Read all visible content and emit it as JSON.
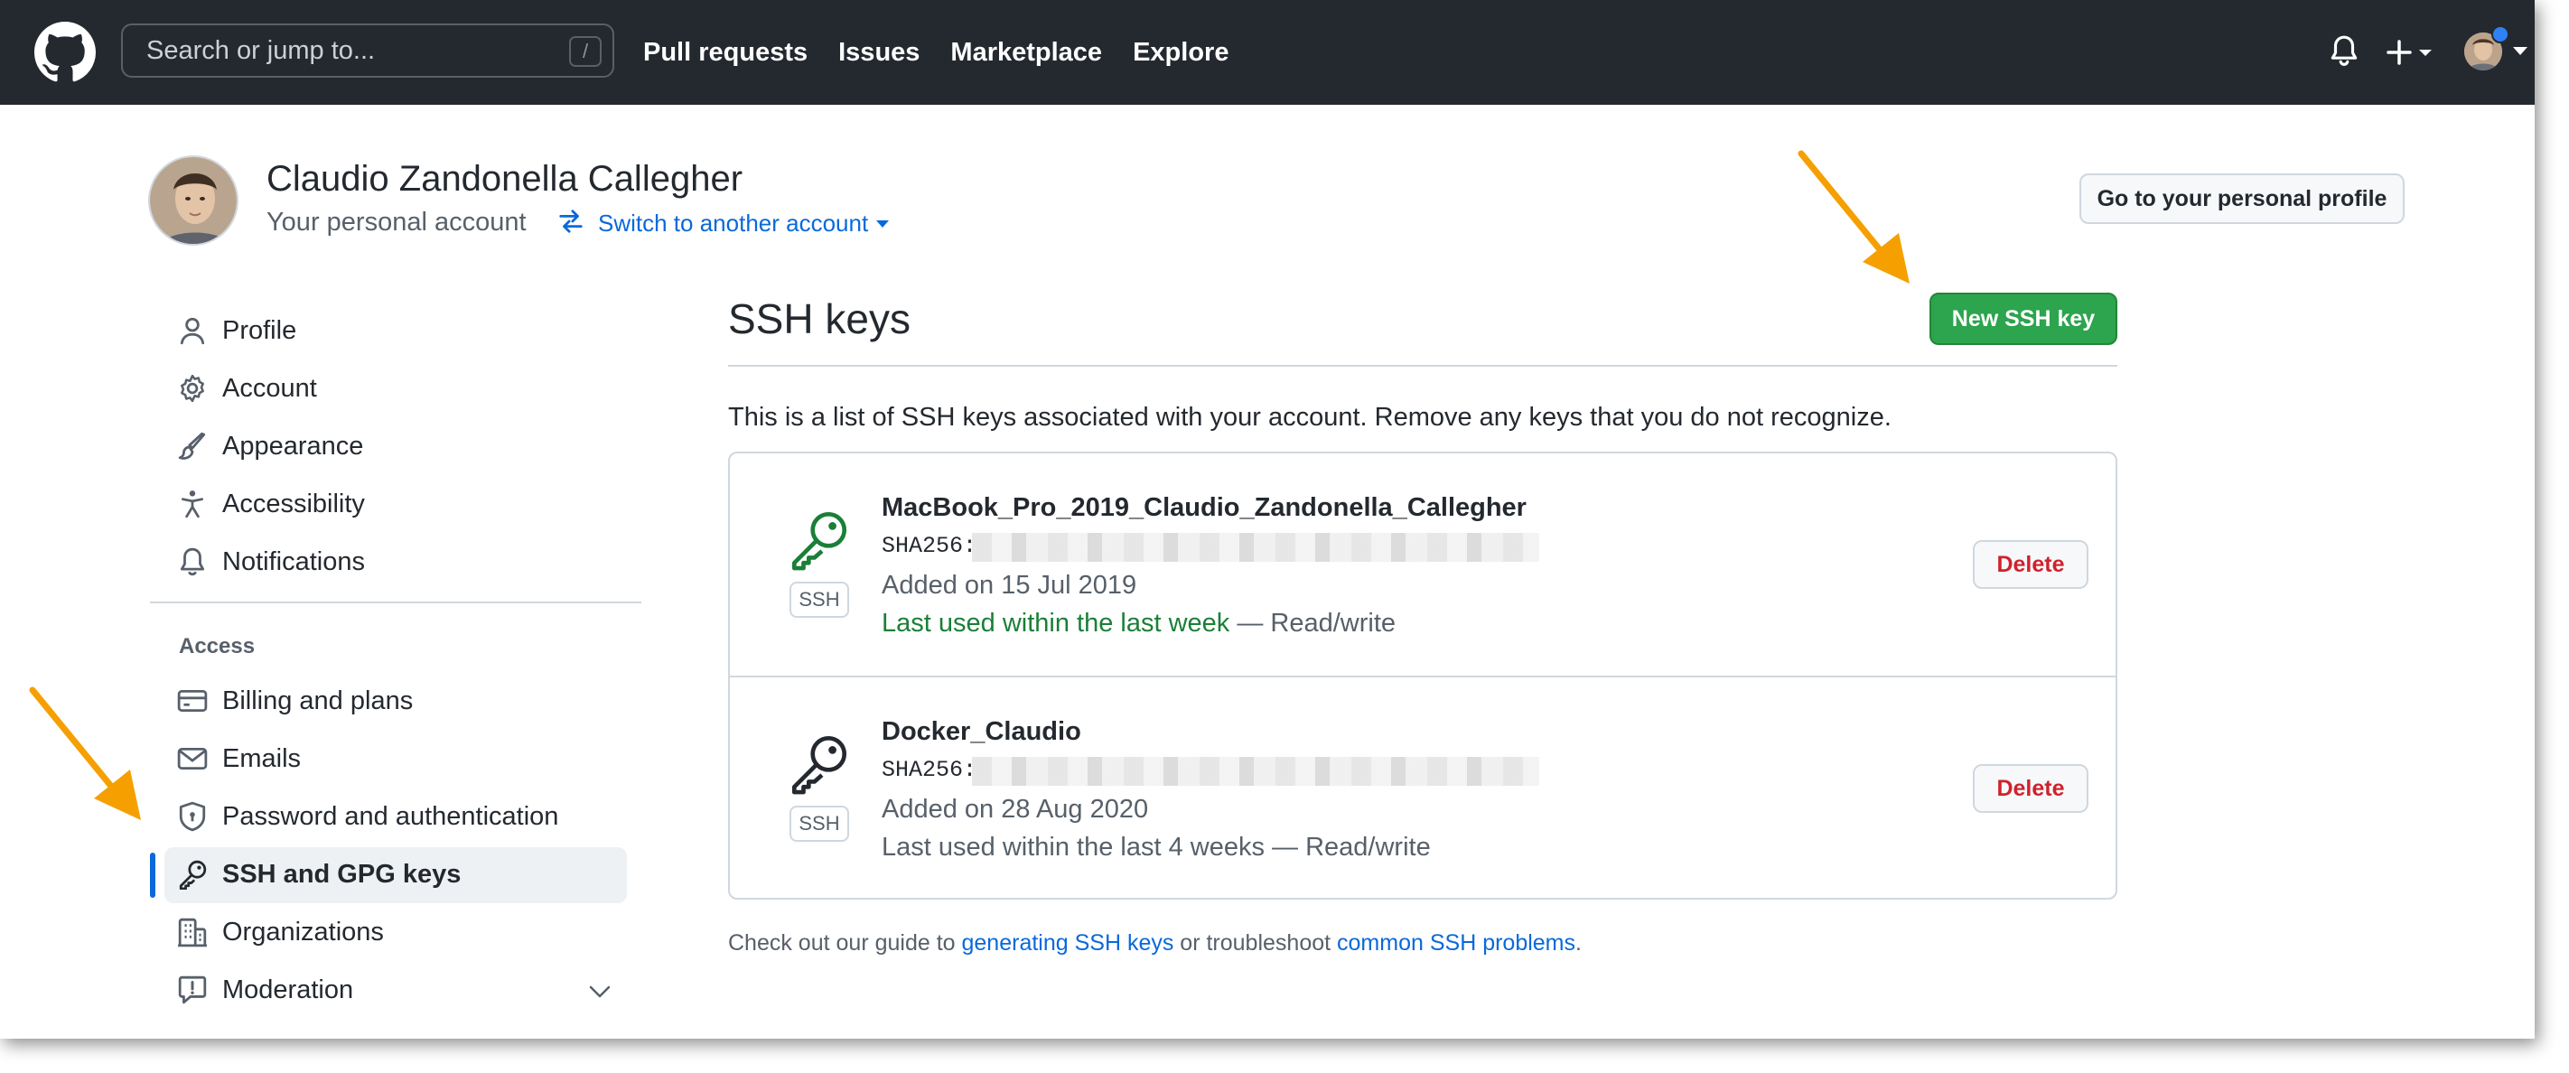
{
  "header": {
    "search_placeholder": "Search or jump to...",
    "search_shortcut": "/",
    "nav": [
      "Pull requests",
      "Issues",
      "Marketplace",
      "Explore"
    ]
  },
  "account": {
    "name": "Claudio Zandonella Callegher",
    "subtitle": "Your personal account",
    "switch_label": "Switch to another account",
    "profile_button": "Go to your personal profile"
  },
  "sidebar": {
    "items": [
      {
        "label": "Profile",
        "icon": "person-icon"
      },
      {
        "label": "Account",
        "icon": "gear-icon"
      },
      {
        "label": "Appearance",
        "icon": "paintbrush-icon"
      },
      {
        "label": "Accessibility",
        "icon": "accessibility-icon"
      },
      {
        "label": "Notifications",
        "icon": "bell-icon"
      }
    ],
    "access_heading": "Access",
    "access_items": [
      {
        "label": "Billing and plans",
        "icon": "credit-card-icon"
      },
      {
        "label": "Emails",
        "icon": "mail-icon"
      },
      {
        "label": "Password and authentication",
        "icon": "shield-lock-icon"
      },
      {
        "label": "SSH and GPG keys",
        "icon": "key-icon",
        "selected": true
      },
      {
        "label": "Organizations",
        "icon": "organization-icon"
      },
      {
        "label": "Moderation",
        "icon": "report-icon"
      }
    ]
  },
  "main": {
    "title": "SSH keys",
    "new_key_button": "New SSH key",
    "intro": "This is a list of SSH keys associated with your account. Remove any keys that you do not recognize.",
    "keys": [
      {
        "name": "MacBook_Pro_2019_Claudio_Zandonella_Callegher",
        "fingerprint_label": "SHA256:",
        "added": "Added on 15 Jul 2019",
        "last_used": "Last used within the last week",
        "access": " — Read/write",
        "badge": "SSH",
        "delete_label": "Delete",
        "active": true
      },
      {
        "name": "Docker_Claudio",
        "fingerprint_label": "SHA256:",
        "added": "Added on 28 Aug 2020",
        "last_used": "Last used within the last 4 weeks",
        "access": " — Read/write",
        "badge": "SSH",
        "delete_label": "Delete",
        "active": false
      }
    ],
    "footer": {
      "prefix": "Check out our guide to ",
      "link1": "generating SSH keys",
      "middle": " or troubleshoot ",
      "link2": "common SSH problems",
      "suffix": "."
    }
  },
  "colors": {
    "header_bg": "#24292f",
    "primary_button": "#2da44e",
    "link": "#0969da",
    "danger": "#cf222e",
    "success_text": "#1a7f37",
    "annotation_arrow": "#f5a000"
  }
}
